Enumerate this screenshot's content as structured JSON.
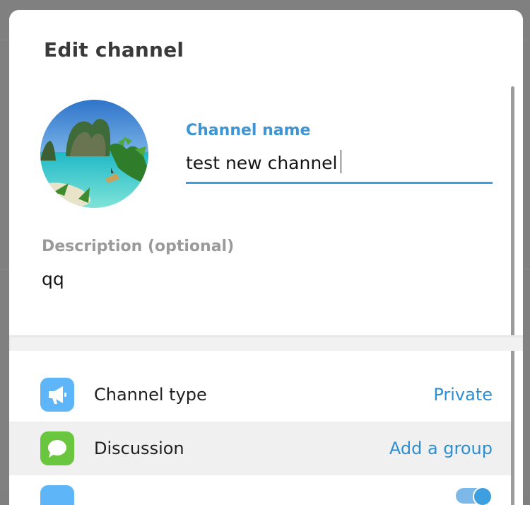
{
  "dialog": {
    "title": "Edit channel"
  },
  "channel_name": {
    "label": "Channel name",
    "value": "test new channel"
  },
  "description": {
    "label": "Description (optional)",
    "value": "qq"
  },
  "settings": [
    {
      "label": "Channel type",
      "value": "Private",
      "icon": "megaphone-icon",
      "icon_color": "#5eb5f7"
    },
    {
      "label": "Discussion",
      "value": "Add a group",
      "icon": "chat-bubble-icon",
      "icon_color": "#6ac53f"
    },
    {
      "label": "",
      "value": "",
      "icon": "signature-icon",
      "icon_color": "#5eb5f7"
    }
  ],
  "colors": {
    "accent": "#3d95d3",
    "link": "#2e8ed0"
  }
}
